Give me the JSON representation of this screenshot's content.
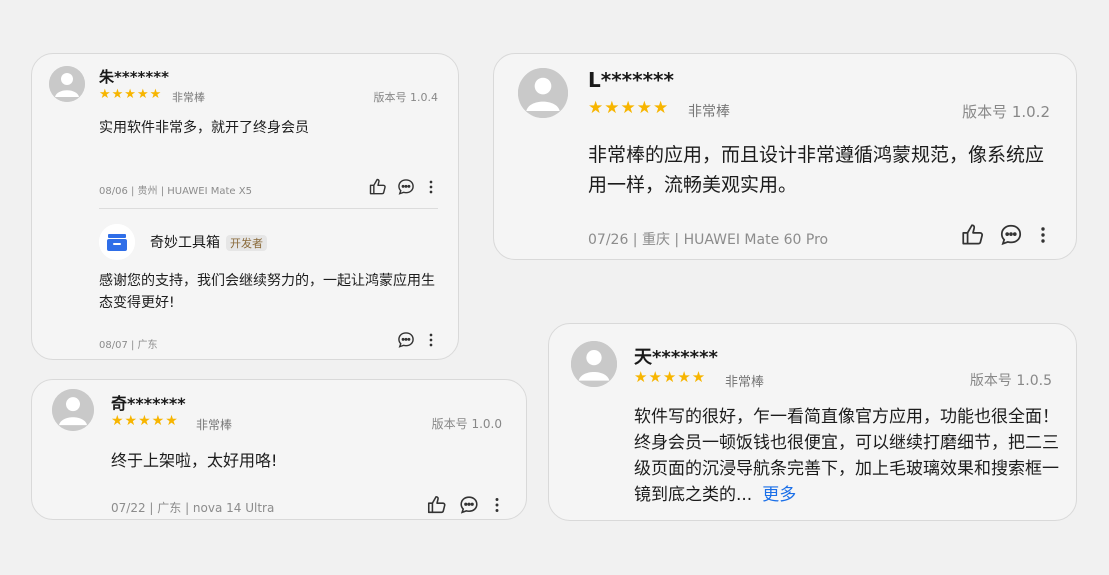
{
  "reviews": [
    {
      "user": "朱*******",
      "stars": "★★★★★",
      "rating_label": "非常棒",
      "version": "版本号 1.0.4",
      "text": "实用软件非常多，就开了终身会员",
      "meta": "08/06 | 贵州 | HUAWEI Mate X5",
      "reply": {
        "developer_name": "奇妙工具箱",
        "badge": "开发者",
        "text": "感谢您的支持，我们会继续努力的，一起让鸿蒙应用生态变得更好!",
        "meta": "08/07 | 广东"
      }
    },
    {
      "user": "奇*******",
      "stars": "★★★★★",
      "rating_label": "非常棒",
      "version": "版本号 1.0.0",
      "text": "终于上架啦，太好用咯!",
      "meta": "07/22 | 广东 | nova 14 Ultra"
    },
    {
      "user": "L*******",
      "stars": "★★★★★",
      "rating_label": "非常棒",
      "version": "版本号 1.0.2",
      "text": "非常棒的应用，而且设计非常遵循鸿蒙规范，像系统应用一样，流畅美观实用。",
      "meta": "07/26 | 重庆 | HUAWEI Mate 60 Pro"
    },
    {
      "user": "天*******",
      "stars": "★★★★★",
      "rating_label": "非常棒",
      "version": "版本号 1.0.5",
      "text": "软件写的很好，乍一看简直像官方应用，功能也很全面！终身会员一顿饭钱也很便宜，可以继续打磨细节，把二三级页面的沉浸导航条完善下，加上毛玻璃效果和搜索框一镜到底之类的...",
      "more": "更多",
      "meta": ""
    }
  ],
  "icons": {
    "like": "thumbs-up-icon",
    "comment": "comment-icon",
    "more": "more-vertical-icon",
    "avatar": "user-avatar-icon",
    "developer": "toolbox-app-icon"
  },
  "colors": {
    "star": "#f7b500",
    "link": "#1a6fe8",
    "developer_icon": "#2f6ee8"
  }
}
